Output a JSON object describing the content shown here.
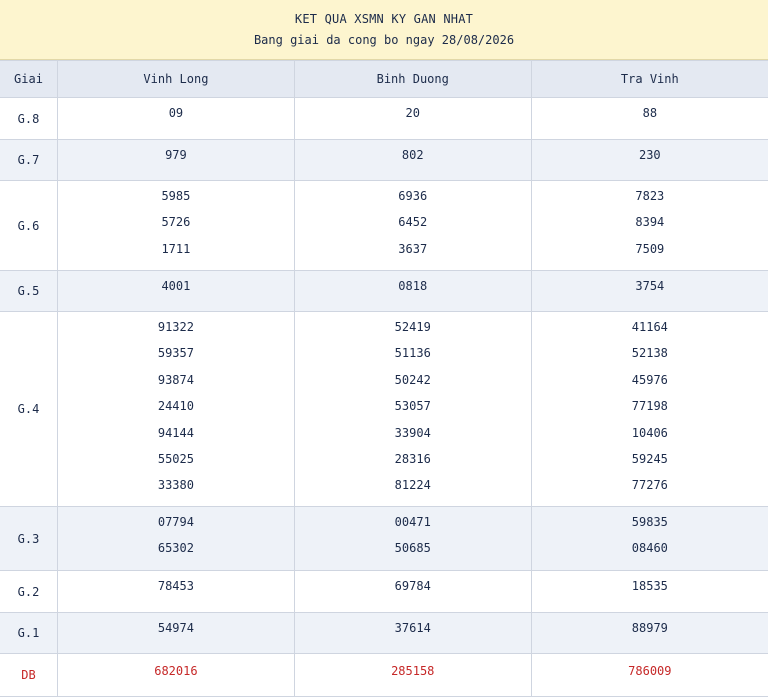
{
  "header": {
    "title": "KET QUA XSMN KY GAN NHAT",
    "subtitle": "Bang giai da cong bo ngay 28/08/2026"
  },
  "columns": {
    "giai": "Giai",
    "provinces": [
      "Vinh Long",
      "Binh Duong",
      "Tra Vinh"
    ]
  },
  "rows": [
    {
      "label": "G.8",
      "values": [
        [
          "09"
        ],
        [
          "20"
        ],
        [
          "88"
        ]
      ]
    },
    {
      "label": "G.7",
      "values": [
        [
          "979"
        ],
        [
          "802"
        ],
        [
          "230"
        ]
      ]
    },
    {
      "label": "G.6",
      "values": [
        [
          "5985",
          "5726",
          "1711"
        ],
        [
          "6936",
          "6452",
          "3637"
        ],
        [
          "7823",
          "8394",
          "7509"
        ]
      ]
    },
    {
      "label": "G.5",
      "values": [
        [
          "4001"
        ],
        [
          "0818"
        ],
        [
          "3754"
        ]
      ]
    },
    {
      "label": "G.4",
      "values": [
        [
          "91322",
          "59357",
          "93874",
          "24410",
          "94144",
          "55025",
          "33380"
        ],
        [
          "52419",
          "51136",
          "50242",
          "53057",
          "33904",
          "28316",
          "81224"
        ],
        [
          "41164",
          "52138",
          "45976",
          "77198",
          "10406",
          "59245",
          "77276"
        ]
      ]
    },
    {
      "label": "G.3",
      "values": [
        [
          "07794",
          "65302"
        ],
        [
          "00471",
          "50685"
        ],
        [
          "59835",
          "08460"
        ]
      ]
    },
    {
      "label": "G.2",
      "values": [
        [
          "78453"
        ],
        [
          "69784"
        ],
        [
          "18535"
        ]
      ]
    },
    {
      "label": "G.1",
      "values": [
        [
          "54974"
        ],
        [
          "37614"
        ],
        [
          "88979"
        ]
      ]
    },
    {
      "label": "DB",
      "values": [
        [
          "682016"
        ],
        [
          "285158"
        ],
        [
          "786009"
        ]
      ]
    }
  ],
  "colors": {
    "header_bg": "#fdf5cf",
    "alt_row_bg": "#eef2f8",
    "special_prize": "#c62828"
  }
}
